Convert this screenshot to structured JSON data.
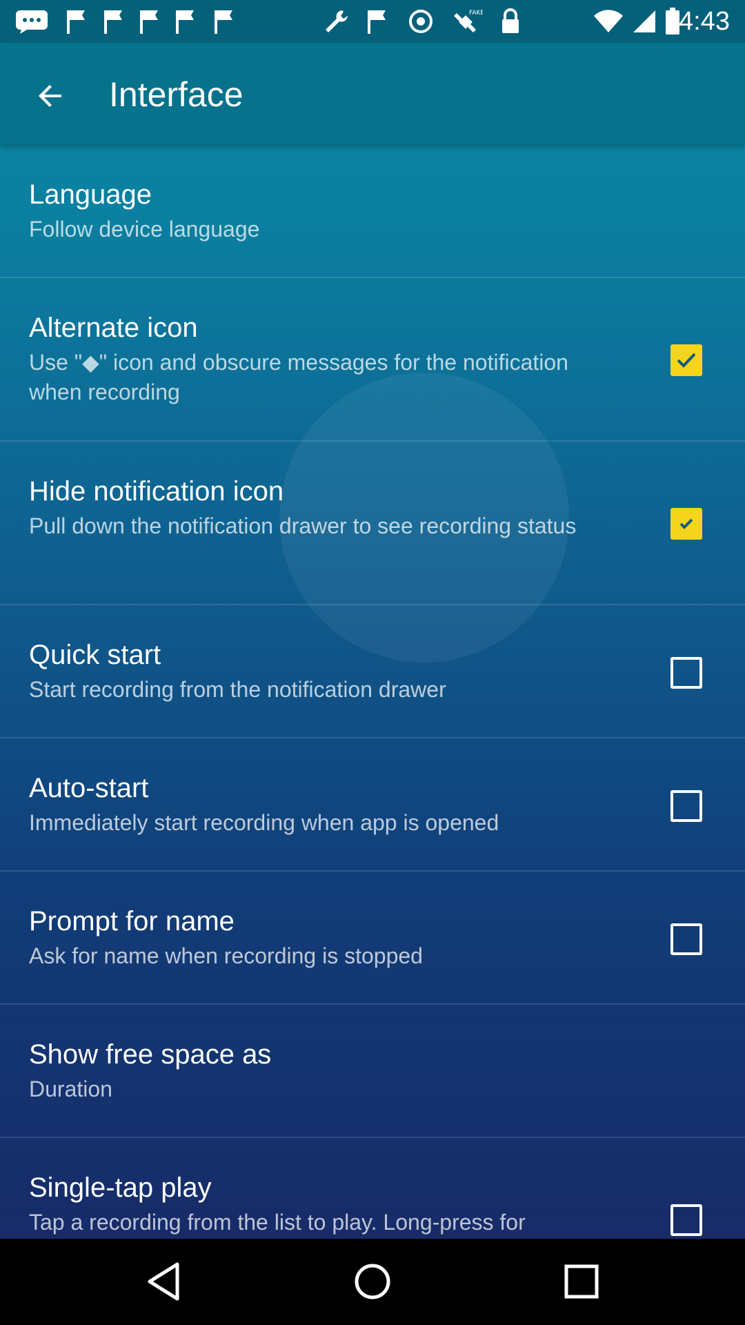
{
  "status_bar": {
    "time": "4:43",
    "left_icons": [
      "chat-icon",
      "flag-icon",
      "flag-icon",
      "wrench-icon",
      "flag-icon",
      "target-icon",
      "satellite-icon",
      "lock-icon"
    ],
    "right_icons": [
      "wifi-icon",
      "signal-icon",
      "battery-icon"
    ]
  },
  "app_bar": {
    "title": "Interface",
    "back_icon": "arrow-back-icon"
  },
  "settings": [
    {
      "title": "Language",
      "summary": "Follow device language",
      "checkbox": null
    },
    {
      "title": "Alternate icon",
      "summary": "Use \"◆\" icon and obscure messages for the notification when recording",
      "checkbox": true
    },
    {
      "title": "Hide notification icon",
      "summary": "Pull down the notification drawer to see recording status",
      "checkbox": true
    },
    {
      "title": "Quick start",
      "summary": "Start recording from the notification drawer",
      "checkbox": false
    },
    {
      "title": "Auto-start",
      "summary": "Immediately start recording when app is opened",
      "checkbox": false
    },
    {
      "title": "Prompt for name",
      "summary": "Ask for name when recording is stopped",
      "checkbox": false
    },
    {
      "title": "Show free space as",
      "summary": "Duration",
      "checkbox": null
    },
    {
      "title": "Single-tap play",
      "summary": "Tap a recording from the list to play. Long-press for",
      "checkbox": false
    }
  ],
  "nav_bar": {
    "buttons": [
      "back-triangle-icon",
      "home-circle-icon",
      "recents-square-icon"
    ]
  },
  "colors": {
    "accent": "#f4d41c",
    "app_bar": "#07728c",
    "status_bar": "#05607a"
  }
}
